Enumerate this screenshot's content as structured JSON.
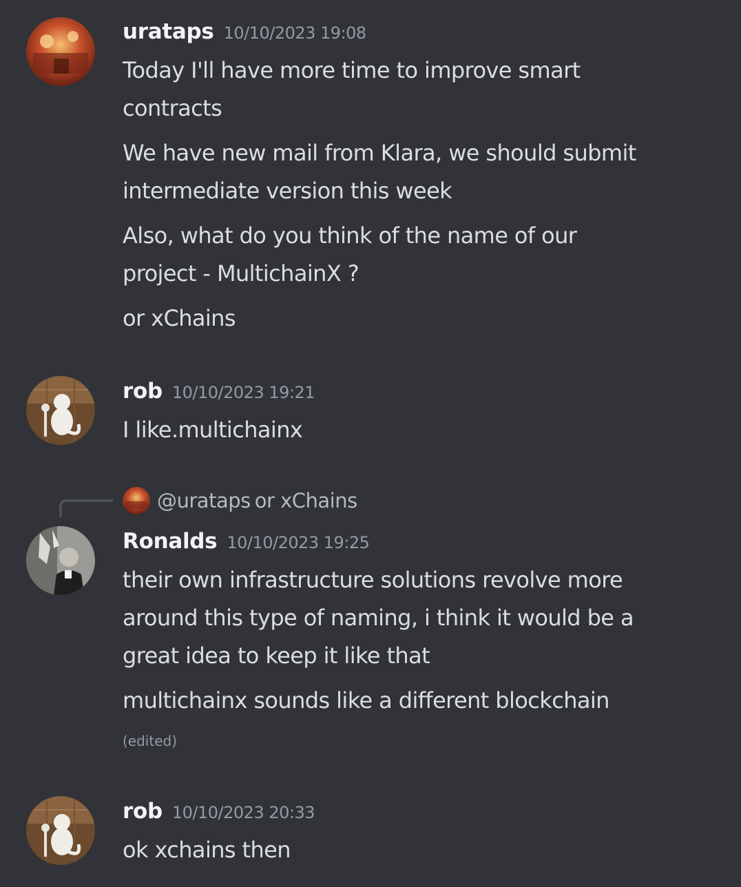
{
  "messages": [
    {
      "username": "urataps",
      "timestamp": "10/10/2023 19:08",
      "avatar": "urataps-avatar",
      "lines": [
        "Today I'll have more time to improve smart",
        "contracts",
        "We have new mail from Klara, we should submit",
        "intermediate version this week",
        "Also, what do you think of the name of our",
        "project - MultichainX ?",
        "or xChains"
      ]
    },
    {
      "username": "rob",
      "timestamp": "10/10/2023 19:21",
      "avatar": "rob-avatar",
      "lines": [
        "I like.multichainx"
      ]
    },
    {
      "reply": {
        "user": "@urataps",
        "content": "or xChains"
      },
      "username": "Ronalds",
      "timestamp": "10/10/2023 19:25",
      "avatar": "ronalds-avatar",
      "lines": [
        "their own infrastructure solutions revolve more",
        "around this type of naming, i think it would be a",
        "great idea to keep it like that",
        "multichainx sounds like a different blockchain"
      ],
      "edited": "(edited)"
    },
    {
      "username": "rob",
      "timestamp": "10/10/2023 20:33",
      "avatar": "rob-avatar",
      "lines": [
        "ok xchains then"
      ]
    }
  ],
  "colors": {
    "background": "#313338",
    "username": "#f2f3f5",
    "timestamp": "#949ba4",
    "text": "#dbdee1"
  }
}
